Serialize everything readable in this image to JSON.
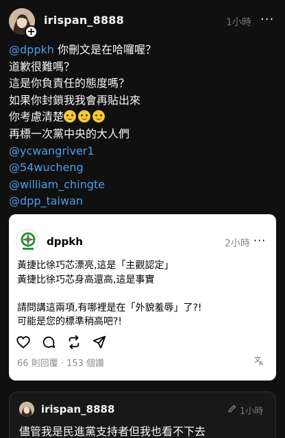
{
  "post": {
    "username": "irispan_8888",
    "time": "1小時",
    "more": "···",
    "lines": [
      {
        "mention": "@dppkh",
        "text": " 你刪文是在哈囉喔？"
      },
      {
        "text": "道歉很難嗎？"
      },
      {
        "text": "這是你負責任的態度嗎？"
      },
      {
        "text": "如果你封鎖我我會再貼出來"
      },
      {
        "text": "你考慮清楚"
      },
      {
        "text": "再標一次黨中央的大人們"
      }
    ],
    "mentions": [
      "@ycwangriver1",
      "@54wucheng",
      "@william_chingte",
      "@dpp_taiwan"
    ],
    "emoji": "slightly-smiling-face-emoji"
  },
  "quote": {
    "username": "dppkh",
    "time": "2小時",
    "more": "···",
    "lines": [
      "黃捷比徐巧芯漂亮,這是「主觀認定」",
      "黃捷比徐巧芯身高還高,這是事實",
      "",
      "請問講這兩項,有哪裡是在「外貌羞辱」了?!",
      "可能是您的標準稍高吧?!"
    ],
    "stats": "66 則回覆 · 153 個讚",
    "translate_icon": "translate-icon",
    "actions": [
      "like-icon",
      "comment-icon",
      "repost-icon",
      "share-icon"
    ]
  },
  "reply": {
    "username": "irispan_8888",
    "time": "1小時",
    "body": "儘管我是民進黨支持者但我也看不下去"
  },
  "colors": {
    "background": "#101010",
    "mention": "#4f9ce6",
    "quote_bg": "#ffffff",
    "muted": "#777777"
  }
}
